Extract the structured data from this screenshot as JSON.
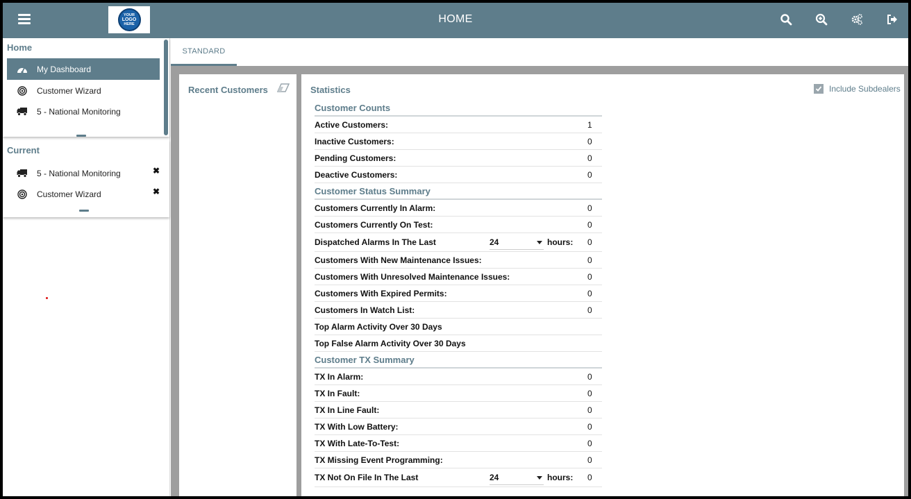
{
  "header": {
    "title": "HOME",
    "logo_text": [
      "YOUR",
      "LOGO",
      "HERE"
    ],
    "icons": [
      "menu-icon",
      "search-icon",
      "zoom-in-icon",
      "settings-gears-icon",
      "logout-icon"
    ],
    "bar_color": "#5e7d8b"
  },
  "sidebar": {
    "home": {
      "title": "Home",
      "items": [
        {
          "label": "My Dashboard",
          "icon": "dashboard-icon",
          "active": true
        },
        {
          "label": "Customer Wizard",
          "icon": "target-icon",
          "active": false
        },
        {
          "label": "5 - National Monitoring",
          "icon": "truck-icon",
          "active": false
        }
      ]
    },
    "current": {
      "title": "Current",
      "items": [
        {
          "label": "5 - National Monitoring",
          "icon": "truck-icon",
          "close": "✖"
        },
        {
          "label": "Customer Wizard",
          "icon": "target-icon",
          "close": "✖"
        }
      ]
    }
  },
  "tabs": [
    {
      "label": "STANDARD",
      "active": true
    }
  ],
  "recent": {
    "title": "Recent Customers"
  },
  "stats": {
    "title": "Statistics",
    "include_subdealers": {
      "label": "Include Subdealers",
      "checked": true
    },
    "groups": [
      {
        "title": "Customer Counts",
        "rows": [
          {
            "label": "Active Customers:",
            "value": "1"
          },
          {
            "label": "Inactive Customers:",
            "value": "0"
          },
          {
            "label": "Pending Customers:",
            "value": "0"
          },
          {
            "label": "Deactive Customers:",
            "value": "0"
          }
        ]
      },
      {
        "title": "Customer Status Summary",
        "rows": [
          {
            "label": "Customers Currently In Alarm:",
            "value": "0"
          },
          {
            "label": "Customers Currently On Test:",
            "value": "0"
          },
          {
            "label": "Dispatched Alarms In The Last",
            "value": "0",
            "select": "24",
            "suffix": "hours:"
          },
          {
            "label": "Customers With New Maintenance Issues:",
            "value": "0"
          },
          {
            "label": "Customers With Unresolved Maintenance Issues:",
            "value": "0"
          },
          {
            "label": "Customers With Expired Permits:",
            "value": "0"
          },
          {
            "label": "Customers In Watch List:",
            "value": "0"
          },
          {
            "label": "Top Alarm Activity Over 30 Days",
            "value": ""
          },
          {
            "label": "Top False Alarm Activity Over 30 Days",
            "value": ""
          }
        ]
      },
      {
        "title": "Customer TX Summary",
        "rows": [
          {
            "label": "TX In Alarm:",
            "value": "0"
          },
          {
            "label": "TX In Fault:",
            "value": "0"
          },
          {
            "label": "TX In Line Fault:",
            "value": "0"
          },
          {
            "label": "TX With Low Battery:",
            "value": "0"
          },
          {
            "label": "TX With Late-To-Test:",
            "value": "0"
          },
          {
            "label": "TX Missing Event Programming:",
            "value": "0"
          },
          {
            "label": "TX Not On File In The Last",
            "value": "0",
            "select": "24",
            "suffix": "hours:"
          }
        ]
      }
    ]
  }
}
